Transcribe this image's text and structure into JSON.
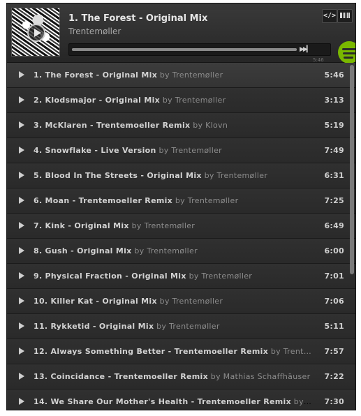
{
  "now_playing": {
    "title": "1. The Forest - Original Mix",
    "artist": "Trentemøller",
    "elapsed": "5:46",
    "progress": 1.0
  },
  "header_buttons": {
    "embed_label": "</>"
  },
  "colors": {
    "accent": "#7ab800",
    "background": "#2b2b2b"
  },
  "tracks": [
    {
      "name": "1. The Forest - Original Mix",
      "artist": "by Trentemøller",
      "duration": "5:46"
    },
    {
      "name": "2. Klodsmajor - Original Mix",
      "artist": "by Trentemøller",
      "duration": "3:13"
    },
    {
      "name": "3. McKlaren - Trentemoeller Remix",
      "artist": "by Klovn",
      "duration": "5:19"
    },
    {
      "name": "4. Snowflake - Live Version",
      "artist": "by Trentemøller",
      "duration": "7:49"
    },
    {
      "name": "5. Blood In The Streets - Original Mix",
      "artist": "by Trentemøller",
      "duration": "6:31"
    },
    {
      "name": "6. Moan - Trentemoeller Remix",
      "artist": "by Trentemøller",
      "duration": "7:25"
    },
    {
      "name": "7. Kink - Original Mix",
      "artist": "by Trentemøller",
      "duration": "6:49"
    },
    {
      "name": "8. Gush - Original Mix",
      "artist": "by Trentemøller",
      "duration": "6:00"
    },
    {
      "name": "9. Physical Fraction - Original Mix",
      "artist": "by Trentemøller",
      "duration": "7:01"
    },
    {
      "name": "10. Killer Kat - Original Mix",
      "artist": "by Trentemøller",
      "duration": "7:06"
    },
    {
      "name": "11. Rykketid - Original Mix",
      "artist": "by Trentemøller",
      "duration": "5:11"
    },
    {
      "name": "12. Always Something Better - Trentemoeller Remix",
      "artist": "by Trent…",
      "duration": "7:57"
    },
    {
      "name": "13. Coincidance - Trentemoeller Remix",
      "artist": "by Mathias Schaffhäuser",
      "duration": "7:22"
    },
    {
      "name": "14. We Share Our Mother's Health - Trentemoeller Remix",
      "artist": "by …",
      "duration": "7:30"
    }
  ],
  "icons": {
    "cover_play": "play-circle-icon",
    "track_play": "play-icon",
    "skip": "skip-forward-icon",
    "logo": "spotify-logo-icon",
    "cursor": "mouse-pointer-icon"
  }
}
